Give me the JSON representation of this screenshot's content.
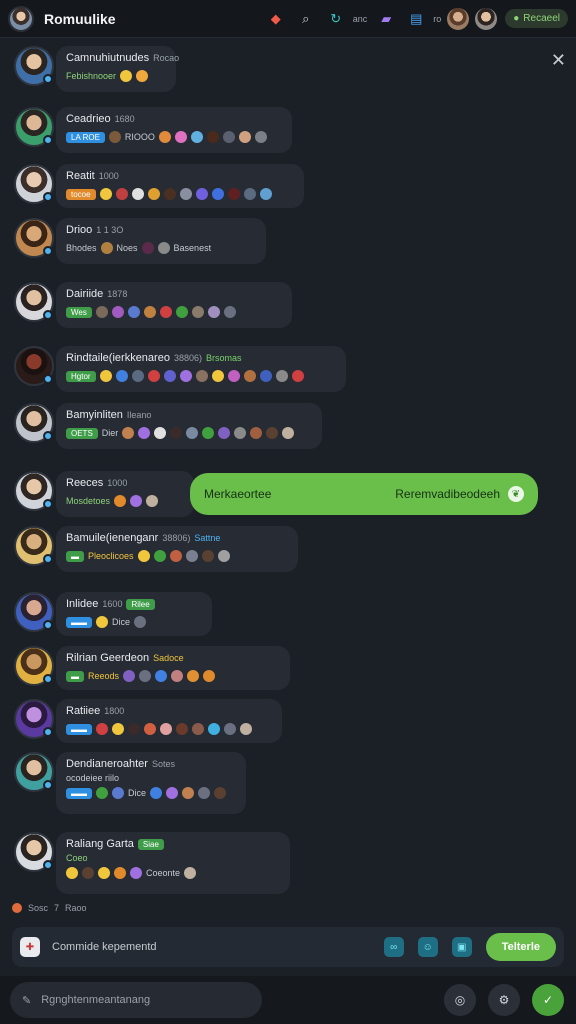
{
  "header": {
    "title": "Romuulike",
    "text1": "anc",
    "text2": "ro",
    "pill": "Recaeel"
  },
  "colors": {
    "accent": "#6abf4b",
    "panel": "#262b34",
    "bg": "#1b1f26"
  },
  "messages": [
    {
      "name": "Camnuhiutnudes",
      "meta": "Rocao",
      "line2_tag": "",
      "line2_text": "Febishnooer",
      "hl": ""
    },
    {
      "name": "Ceadrieo",
      "meta": "1680",
      "line2_tag": "LA ROE",
      "line2_text": "RIOOO",
      "hl": ""
    },
    {
      "name": "Reatit",
      "meta": "1000",
      "line2_tag": "tocoe",
      "line2_text": "",
      "hl": ""
    },
    {
      "name": "Drioo",
      "meta": "1 1 3O",
      "line2_tag": "",
      "line2_text": "Bhodes",
      "extra": "Noes",
      "extra2": "Basenest",
      "hl": ""
    },
    {
      "name": "Dairiide",
      "meta": "1878",
      "line2_tag": "Wes",
      "line2_text": "",
      "hl": ""
    },
    {
      "name": "Rindtaile(ierkkenareo",
      "meta": "38806)",
      "line2_tag": "Hgtor",
      "line2_text": "",
      "hl": "Brsomas"
    },
    {
      "name": "Bamyinliten",
      "meta": "Ileano",
      "line2_tag": "OETS",
      "line2_text": "Dier",
      "hl": ""
    },
    {
      "name": "Reeces",
      "meta": "1000",
      "line2_tag": "",
      "line2_text": "Mosdetoes",
      "hl": ""
    },
    {
      "name": "Bamuile(ienenganr",
      "meta": "38806)",
      "line2_tag": "",
      "line2_text": "Pleoclicoes",
      "hl": "Sattne"
    },
    {
      "name": "Inlidee",
      "meta": "1600",
      "line2_tag": "",
      "line2_text": "Dice",
      "hl": "Rilee"
    },
    {
      "name": "Rilrian Geerdeon",
      "meta": "",
      "line2_tag": "",
      "line2_text": "Reeods",
      "hl": "Sadoce"
    },
    {
      "name": "Ratiiee",
      "meta": "1800",
      "line2_tag": "",
      "line2_text": "",
      "hl": ""
    },
    {
      "name": "Dendianeroahter",
      "meta": "Sotes",
      "line2_tag": "",
      "line2_text": "Dice",
      "hl": ""
    },
    {
      "name": "Raliang Garta",
      "meta": "",
      "line2_tag": "",
      "line2_text": "Coeonte",
      "hl": "Siae"
    }
  ],
  "message_line3": {
    "d": "ocodeiee riilo",
    "e": "Coeo"
  },
  "sent": {
    "left": "Merkaeortee",
    "right": "Reremvadibeodeeh"
  },
  "reactions": {
    "a": "Sosc",
    "b": "7",
    "c": "Raoo"
  },
  "composer": {
    "placeholder": "Commide kepementd",
    "send_label": "Telterle"
  },
  "bottom": {
    "input_placeholder": "Rgnghtenmeantanang"
  }
}
